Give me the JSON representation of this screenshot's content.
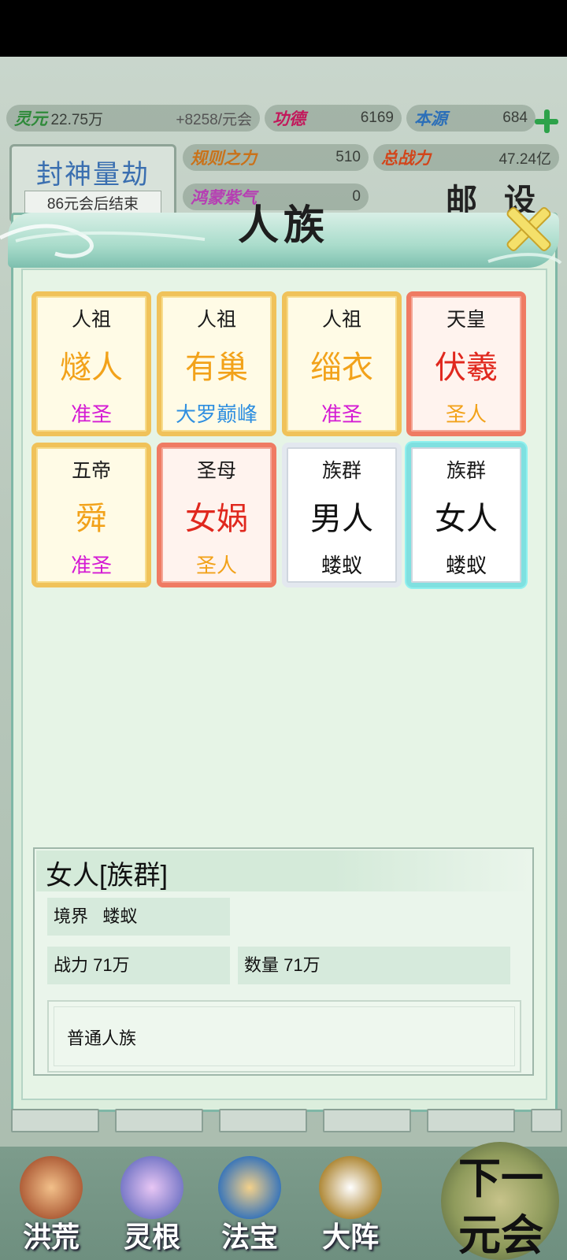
{
  "resources": {
    "lingyuan": {
      "label": "灵元",
      "value": "22.75万",
      "rate": "+8258/元会"
    },
    "gongde": {
      "label": "功德",
      "value": "6169"
    },
    "benyuan": {
      "label": "本源",
      "value": "684"
    },
    "guize": {
      "label": "规则之力",
      "value": "510"
    },
    "zongzhanli": {
      "label": "总战力",
      "value": "47.24亿"
    },
    "hongmeng": {
      "label": "鸿蒙紫气",
      "value": "0"
    }
  },
  "kalpa": {
    "title": "封神量劫",
    "subtitle": "86元会后结束"
  },
  "top_buttons": {
    "mail": "邮",
    "settings": "设"
  },
  "modal": {
    "title": "人族",
    "cards": [
      {
        "top": "人祖",
        "name": "燧人",
        "rank": "准圣",
        "style": "gold",
        "name_color": "#f2a21a",
        "rank_color": "#d41ad4"
      },
      {
        "top": "人祖",
        "name": "有巢",
        "rank": "大罗巅峰",
        "style": "gold",
        "name_color": "#f2a21a",
        "rank_color": "#2f8fe0"
      },
      {
        "top": "人祖",
        "name": "缁衣",
        "rank": "准圣",
        "style": "gold",
        "name_color": "#f2a21a",
        "rank_color": "#d41ad4"
      },
      {
        "top": "天皇",
        "name": "伏羲",
        "rank": "圣人",
        "style": "red",
        "name_color": "#e0281e",
        "rank_color": "#f2a21a"
      },
      {
        "top": "五帝",
        "name": "舜",
        "rank": "准圣",
        "style": "gold",
        "name_color": "#f2a21a",
        "rank_color": "#d41ad4"
      },
      {
        "top": "圣母",
        "name": "女娲",
        "rank": "圣人",
        "style": "red",
        "name_color": "#e0281e",
        "rank_color": "#f2a21a"
      },
      {
        "top": "族群",
        "name": "男人",
        "rank": "蝼蚁",
        "style": "white",
        "name_color": "#111111",
        "rank_color": "#111111"
      },
      {
        "top": "族群",
        "name": "女人",
        "rank": "蝼蚁",
        "style": "white",
        "name_color": "#111111",
        "rank_color": "#111111",
        "selected": true
      }
    ],
    "detail": {
      "title": "女人[族群]",
      "realm_label": "境界",
      "realm_value": "蝼蚁",
      "power_label": "战力",
      "power_value": "71万",
      "count_label": "数量",
      "count_value": "71万",
      "description": "普通人族"
    }
  },
  "bottom_nav": [
    {
      "label": "洪荒",
      "icon": "mountain-icon"
    },
    {
      "label": "灵根",
      "icon": "lotus-icon"
    },
    {
      "label": "法宝",
      "icon": "treasure-icon"
    },
    {
      "label": "大阵",
      "icon": "taiji-icon"
    }
  ],
  "next_button": {
    "line1": "下一",
    "line2": "元会"
  }
}
